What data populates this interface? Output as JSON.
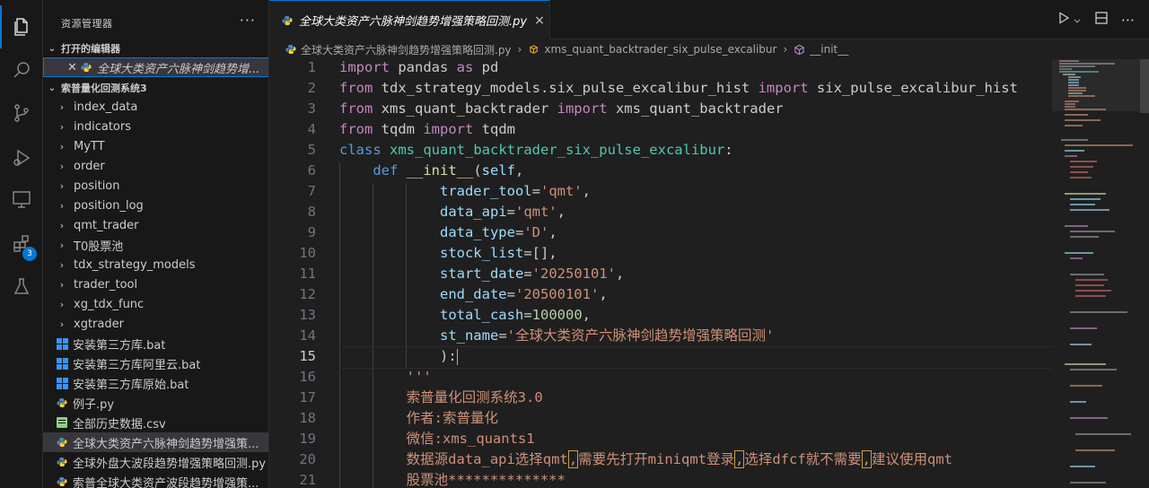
{
  "explorer": {
    "title": "资源管理器",
    "more": "···",
    "open_editors_label": "打开的编辑器",
    "open_editor_item": "全球大类资产六脉神剑趋势增...",
    "project_label": "索普量化回测系统3",
    "folders": [
      "index_data",
      "indicators",
      "MyTT",
      "order",
      "position",
      "position_log",
      "qmt_trader",
      "T0股票池",
      "tdx_strategy_models",
      "trader_tool",
      "xg_tdx_func",
      "xgtrader"
    ],
    "files": [
      {
        "name": "安装第三方库.bat",
        "icon": "windows-icon"
      },
      {
        "name": "安装第三方库阿里云.bat",
        "icon": "windows-icon"
      },
      {
        "name": "安装第三方库原始.bat",
        "icon": "windows-icon"
      },
      {
        "name": "例子.py",
        "icon": "python-icon"
      },
      {
        "name": "全部历史数据.csv",
        "icon": "csv-icon"
      },
      {
        "name": "全球大类资产六脉神剑趋势增强策...",
        "icon": "python-icon"
      },
      {
        "name": "全球外盘大波段趋势增强策略回测.py",
        "icon": "python-icon"
      },
      {
        "name": "索普全球大类资产波段趋势增强策...",
        "icon": "python-icon"
      }
    ]
  },
  "activity_badge": "3",
  "tab": {
    "label": "全球大类资产六脉神剑趋势增强策略回测.py",
    "close": "×"
  },
  "breadcrumb": {
    "file": "全球大类资产六脉神剑趋势增强策略回测.py",
    "class": "xms_quant_backtrader_six_pulse_excalibur",
    "method": "__init__"
  },
  "code": {
    "line_numbers": [
      "1",
      "2",
      "3",
      "4",
      "5",
      "6",
      "7",
      "8",
      "9",
      "10",
      "11",
      "12",
      "13",
      "14",
      "15",
      "16",
      "17",
      "18",
      "19",
      "20",
      "21"
    ],
    "l1": [
      "import",
      " pandas ",
      "as",
      " pd"
    ],
    "l2": [
      "from",
      " tdx_strategy_models.six_pulse_excalibur_hist ",
      "import",
      " six_pulse_excalibur_hist"
    ],
    "l3": [
      "from",
      " xms_quant_backtrader ",
      "import",
      " xms_quant_backtrader"
    ],
    "l4": [
      "from",
      " tqdm ",
      "import",
      " tqdm"
    ],
    "l5": [
      "class",
      " ",
      "xms_quant_backtrader_six_pulse_excalibur",
      ":"
    ],
    "l6": [
      "def",
      " ",
      "__init__",
      "(",
      "self",
      ","
    ],
    "l7": [
      "trader_tool",
      "=",
      "'qmt'",
      ","
    ],
    "l8": [
      "data_api",
      "=",
      "'qmt'",
      ","
    ],
    "l9": [
      "data_type",
      "=",
      "'D'",
      ","
    ],
    "l10": [
      "stock_list",
      "=[],"
    ],
    "l11": [
      "start_date",
      "=",
      "'20250101'",
      ","
    ],
    "l12": [
      "end_date",
      "=",
      "'20500101'",
      ","
    ],
    "l13": [
      "total_cash",
      "=",
      "100000",
      ","
    ],
    "l14": [
      "st_name",
      "=",
      "'全球大类资产六脉神剑趋势增强策略回测'"
    ],
    "l15": "):",
    "l16": "'''",
    "l17": "索普量化回测系统3.0",
    "l18": "作者:索普量化",
    "l19": "微信:xms_quants1",
    "l20": [
      "数据源data_api选择qmt",
      ",",
      "需要先打开miniqmt登录",
      ",",
      "选择dfcf就不需要",
      ",",
      "建议使用qmt"
    ],
    "l21": "股票池**************"
  }
}
